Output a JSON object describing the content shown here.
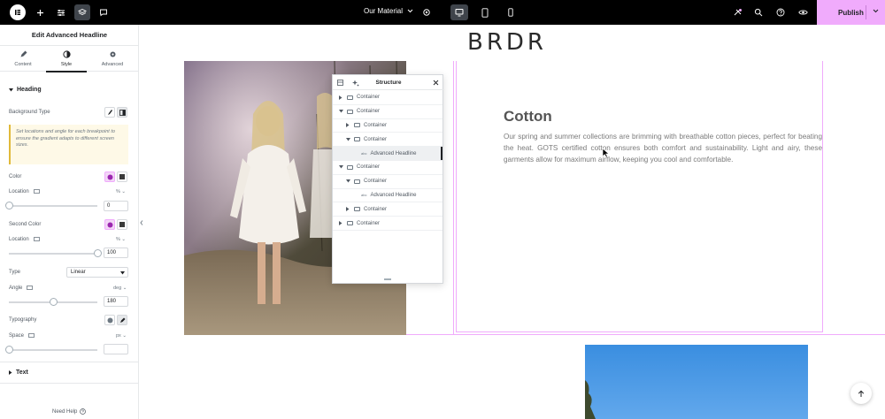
{
  "topbar": {
    "document_title": "Our Material",
    "publish_label": "Publish",
    "icons": [
      "elementor-logo-icon",
      "add-icon",
      "settings-sliders-icon",
      "layers-icon",
      "comments-icon",
      "chevron-down-icon",
      "gear-icon",
      "desktop-icon",
      "tablet-icon",
      "mobile-icon",
      "notifications-icon",
      "search-icon",
      "help-icon",
      "preview-eye-icon"
    ],
    "accent_color": "#f0abfc"
  },
  "panel": {
    "title": "Edit Advanced Headline",
    "tabs": [
      {
        "label": "Content",
        "icon": "pencil-icon"
      },
      {
        "label": "Style",
        "icon": "half-circle-icon"
      },
      {
        "label": "Advanced",
        "icon": "gear-icon"
      }
    ],
    "active_tab": "Style",
    "heading_section": "Heading",
    "background_type_label": "Background Type",
    "notice": "Set locations and angle for each breakpoint to ensure the gradient adapts to different screen sizes.",
    "color_label": "Color",
    "location_label": "Location",
    "location_unit": "%",
    "location_value": "0",
    "location_level": 0,
    "second_color_label": "Second Color",
    "second_location_label": "Location",
    "second_location_unit": "%",
    "second_location_value": "100",
    "second_location_level": 1,
    "type_label": "Type",
    "type_value": "Linear",
    "angle_label": "Angle",
    "angle_unit": "deg",
    "angle_value": "180",
    "angle_level": 0.5,
    "typography_label": "Typography",
    "space_label": "Space",
    "space_unit": "px",
    "space_value": "",
    "text_section": "Text",
    "need_help": "Need Help"
  },
  "canvas": {
    "brand": "BRDR",
    "heading": "Cotton",
    "paragraph": "Our spring and summer collections are brimming with breathable cotton pieces, perfect for beating the heat. GOTS certified cotton ensures both comfort and sustainability. Light and airy, these garments allow for maximum airflow, keeping you cool and comfortable."
  },
  "structure": {
    "title": "Structure",
    "rows": [
      {
        "label": "Container",
        "depth": 0,
        "expanded": false,
        "kind": "container",
        "selected": false
      },
      {
        "label": "Container",
        "depth": 0,
        "expanded": true,
        "kind": "container",
        "selected": false
      },
      {
        "label": "Container",
        "depth": 1,
        "expanded": false,
        "kind": "container",
        "selected": false
      },
      {
        "label": "Container",
        "depth": 1,
        "expanded": true,
        "kind": "container",
        "selected": false
      },
      {
        "label": "Advanced Headline",
        "depth": 2,
        "expanded": null,
        "kind": "widget",
        "selected": true
      },
      {
        "label": "Container",
        "depth": 0,
        "expanded": true,
        "kind": "container",
        "selected": false
      },
      {
        "label": "Container",
        "depth": 1,
        "expanded": true,
        "kind": "container",
        "selected": false
      },
      {
        "label": "Advanced Headline",
        "depth": 2,
        "expanded": null,
        "kind": "widget",
        "selected": false
      },
      {
        "label": "Container",
        "depth": 1,
        "expanded": false,
        "kind": "container",
        "selected": false
      },
      {
        "label": "Container",
        "depth": 0,
        "expanded": false,
        "kind": "container",
        "selected": false
      }
    ]
  }
}
